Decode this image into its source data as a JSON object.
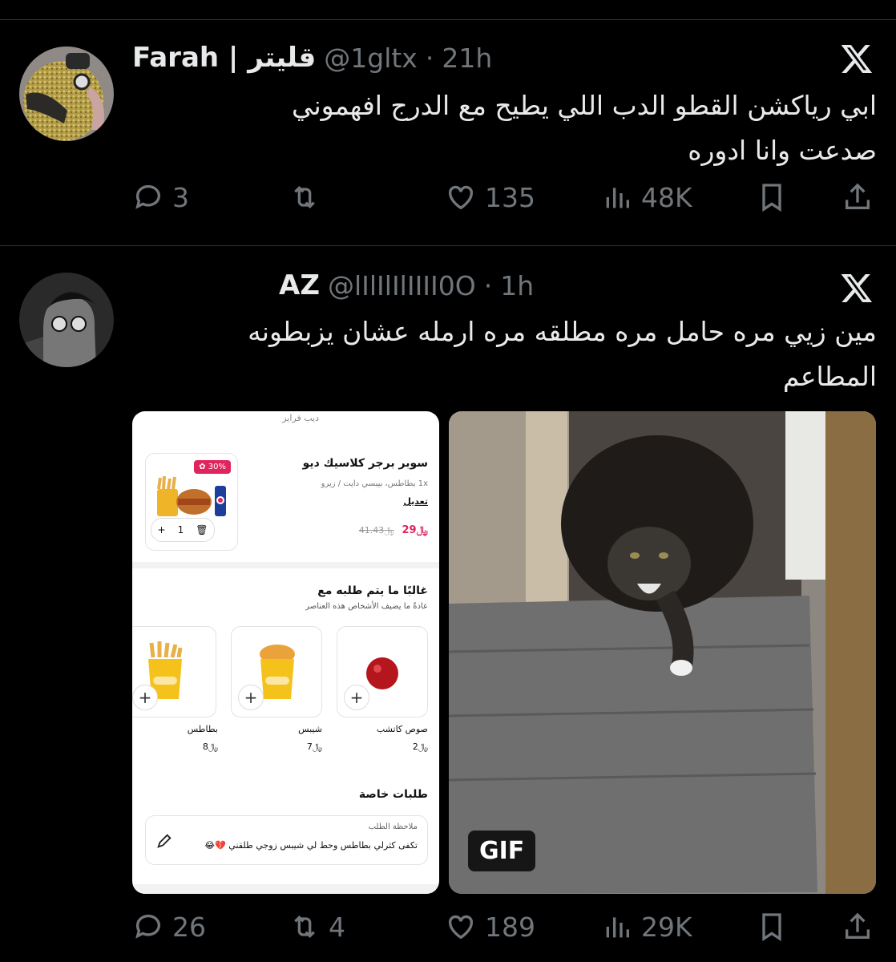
{
  "tweets": [
    {
      "name": "Farah | قليتر",
      "handle": "@1gltx",
      "time": "21h",
      "text_lines": [
        "ابي رياكشن القطو الدب اللي يطيح مع الدرج افهموني",
        "صدعت وانا ادوره"
      ],
      "replies": "3",
      "retweets": "",
      "likes": "135",
      "views": "48K"
    },
    {
      "name": "AZ",
      "handle": "@lIlIlIlIIII0O",
      "time": "1h",
      "text_lines": [
        "مين زيي مره حامل مره مطلقه مره ارمله عشان يزبطونه",
        "المطاعم"
      ],
      "replies": "26",
      "retweets": "4",
      "likes": "189",
      "views": "29K"
    }
  ],
  "media": {
    "gif_badge": "GIF",
    "app": {
      "top_label": "ديب فرايز",
      "item_title": "سوبر برجر كلاسيك ديو",
      "item_desc": "1x بطاطس، بيبسي دايت / زيرو",
      "edit_label": "تعديل",
      "discount_badge": "30%",
      "price_new": "29",
      "price_old": "41.43",
      "qty": "1",
      "upsell_title": "غالبًا ما يتم طلبه مع",
      "upsell_subtitle": "عادةً ما يضيف الأشخاص هذه العناصر",
      "upsell_items": [
        {
          "name": "صوص كاتشب",
          "price": "2"
        },
        {
          "name": "شيبس",
          "price": "7"
        },
        {
          "name": "بطاطس",
          "price": "8"
        }
      ],
      "special_title": "طلبات خاصة",
      "note_label": "ملاحظة الطلب",
      "note_text": "تكفى كثرلي بطاطس وحط لي شيبس زوجي طلقني 💔😂",
      "currency_symbol": "﷼"
    }
  },
  "colors": {
    "background": "#000000",
    "text": "#e7e9ea",
    "muted": "#71767b",
    "divider": "#2f3336",
    "price_red": "#e0245e"
  }
}
